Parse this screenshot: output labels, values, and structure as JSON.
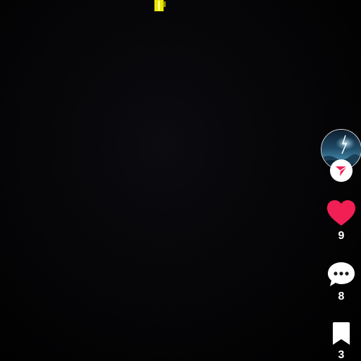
{
  "video": {
    "description": ""
  },
  "rail": {
    "like_count": "9",
    "comment_count": "8",
    "save_count": "3"
  },
  "colors": {
    "background": "#000000",
    "like": "#f21f55",
    "accent_yellow": "#f4f000",
    "text": "#ffffff"
  },
  "icons": {
    "follow": "send-arrow-icon",
    "like": "heart-icon",
    "comment": "comment-bubble-icon",
    "save": "bookmark-icon"
  }
}
